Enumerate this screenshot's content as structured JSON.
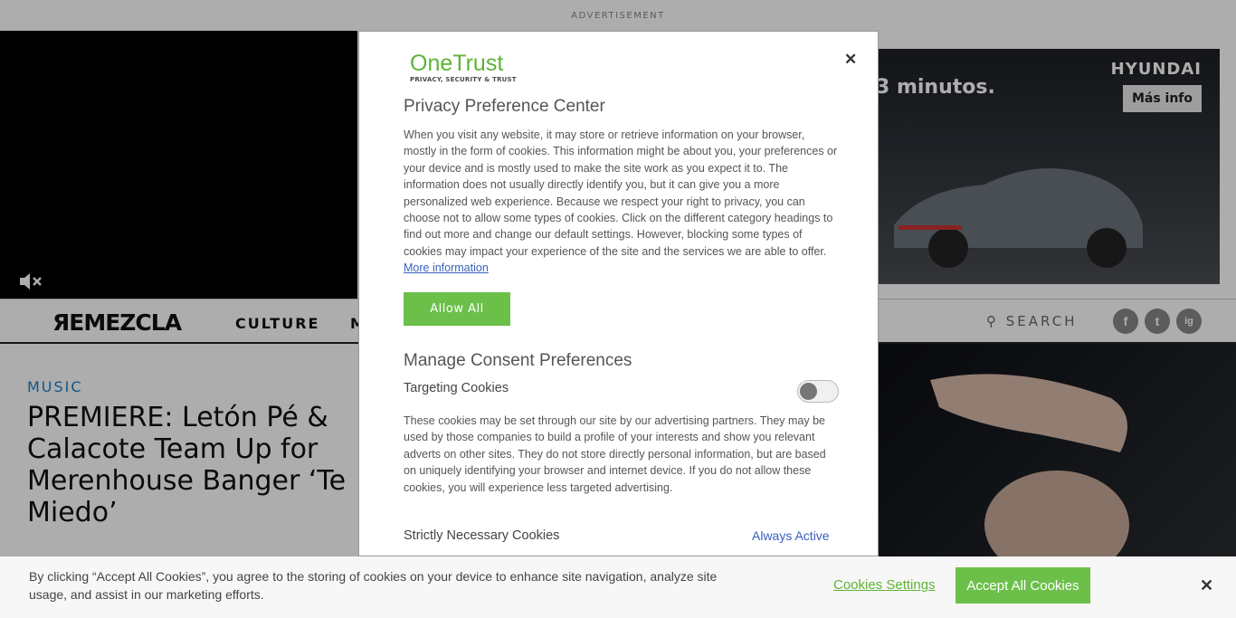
{
  "page": {
    "ad_label": "ADVERTISEMENT",
    "ad": {
      "headline": "3 minutos.",
      "brand": "HYUNDAI",
      "cta": "Más info"
    },
    "nav": {
      "logo": "ЯEMEZCLA",
      "items": [
        "CULTURE",
        "M"
      ],
      "search": "SEARCH",
      "social": [
        "f",
        "t",
        "ig"
      ]
    },
    "article": {
      "category": "MUSIC",
      "headline": "PREMIERE: Letón Pé & Calacote Team Up for Merenhouse Banger ‘Te Miedo’"
    }
  },
  "modal": {
    "logo_brand": "OneTrust",
    "logo_tagline": "PRIVACY, SECURITY & TRUST",
    "title": "Privacy Preference Center",
    "description": "When you visit any website, it may store or retrieve information on your browser, mostly in the form of cookies. This information might be about you, your preferences or your device and is mostly used to make the site work as you expect it to. The information does not usually directly identify you, but it can give you a more personalized web experience. Because we respect your right to privacy, you can choose not to allow some types of cookies. Click on the different category headings to find out more and change our default settings. However, blocking some types of cookies may impact your experience of the site and the services we are able to offer.",
    "more_info": "More information",
    "allow_all": "Allow All",
    "manage_title": "Manage Consent Preferences",
    "categories": [
      {
        "name": "Targeting Cookies",
        "description": "These cookies may be set through our site by our advertising partners. They may be used by those companies to build a profile of your interests and show you relevant adverts on other sites. They do not store directly personal information, but are based on uniquely identifying your browser and internet device. If you do not allow these cookies, you will experience less targeted advertising."
      },
      {
        "name": "Strictly Necessary Cookies",
        "status": "Always Active"
      }
    ]
  },
  "cookie_bar": {
    "text": "By clicking “Accept All Cookies”, you agree to the storing of cookies on your device to enhance site navigation, analyze site usage, and assist in our marketing efforts.",
    "settings": "Cookies Settings",
    "accept": "Accept All Cookies"
  },
  "colors": {
    "accent_green": "#6cc04a",
    "link_blue": "#3860be",
    "category_blue": "#1a7fc9"
  },
  "icons": {
    "mute": "volume-mute-icon",
    "close": "close-icon",
    "search": "search-icon"
  }
}
